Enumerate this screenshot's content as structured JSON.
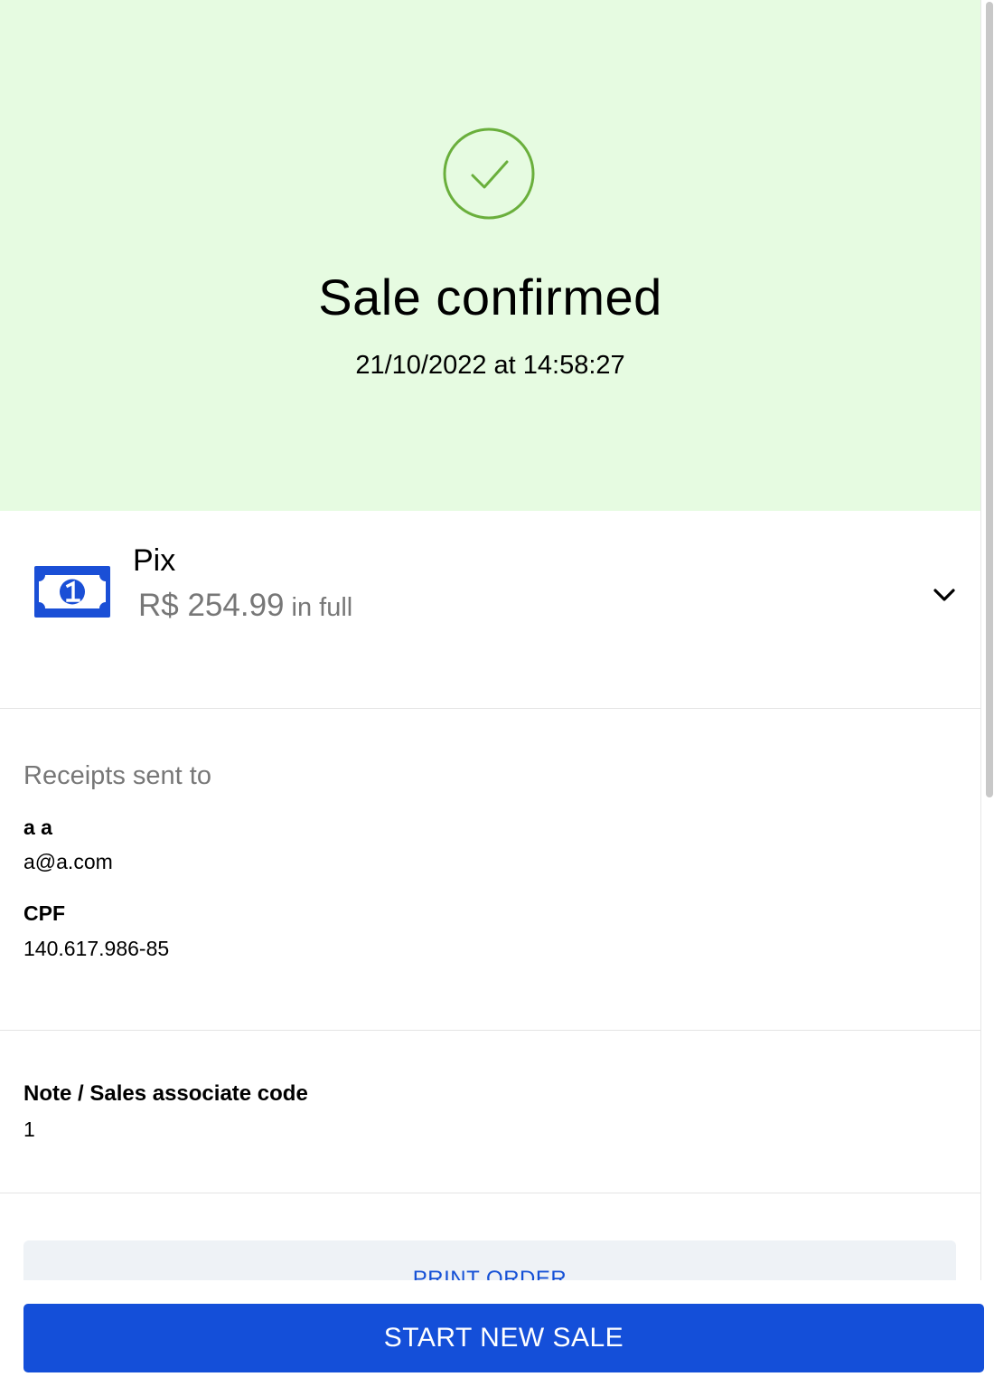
{
  "confirmation": {
    "title": "Sale confirmed",
    "datetime": "21/10/2022 at 14:58:27",
    "icon": "check-circle-icon",
    "accent_color": "#6aaf3c",
    "background_color": "#e6fbe1"
  },
  "payment": {
    "method": "Pix",
    "amount": "R$ 254.99",
    "installments": "in full",
    "icon": "money-bill-icon",
    "icon_color": "#1a4fd6"
  },
  "receipts": {
    "label": "Receipts sent to",
    "name": "a a",
    "email": "a@a.com",
    "document_label": "CPF",
    "document_value": "140.617.986-85"
  },
  "note": {
    "label": "Note / Sales associate code",
    "value": "1"
  },
  "actions": {
    "print_label": "PRINT ORDER",
    "start_new_sale_label": "START NEW SALE",
    "primary_color": "#144fd9"
  }
}
